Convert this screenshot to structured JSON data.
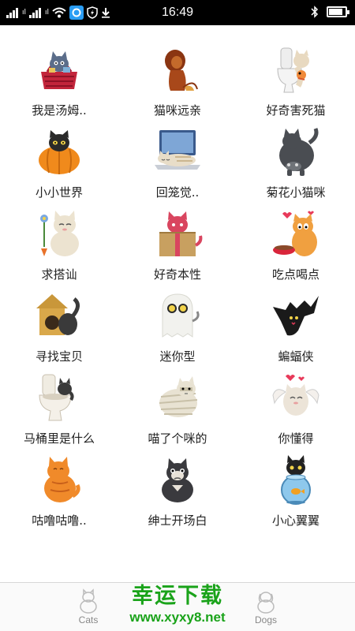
{
  "status_bar": {
    "time": "16:49",
    "signal_label_1": "ıl",
    "signal_label_2": "ıl"
  },
  "stickers": [
    {
      "label": "我是汤姆..",
      "icon": "cat-in-basket-icon"
    },
    {
      "label": "猫咪远亲",
      "icon": "lion-icon"
    },
    {
      "label": "好奇害死猫",
      "icon": "cat-toilet-icon"
    },
    {
      "label": "小小世界",
      "icon": "cat-pumpkin-icon"
    },
    {
      "label": "回笼觉..",
      "icon": "cat-laptop-icon"
    },
    {
      "label": "菊花小猫咪",
      "icon": "cat-back-icon"
    },
    {
      "label": "求搭讪",
      "icon": "cat-flower-icon"
    },
    {
      "label": "好奇本性",
      "icon": "cat-gift-box-icon"
    },
    {
      "label": "吃点喝点",
      "icon": "cat-food-bowl-icon"
    },
    {
      "label": "寻找宝贝",
      "icon": "cat-house-icon"
    },
    {
      "label": "迷你型",
      "icon": "cat-ghost-icon"
    },
    {
      "label": "蝙蝠侠",
      "icon": "cat-bat-icon"
    },
    {
      "label": "马桶里是什么",
      "icon": "cat-toilet-bowl-icon"
    },
    {
      "label": "喵了个咪的",
      "icon": "cat-mummy-icon"
    },
    {
      "label": "你懂得",
      "icon": "cat-wings-icon"
    },
    {
      "label": "咕噜咕噜..",
      "icon": "orange-cat-icon"
    },
    {
      "label": "绅士开场白",
      "icon": "cat-gentleman-icon"
    },
    {
      "label": "小心翼翼",
      "icon": "cat-fishbowl-icon"
    }
  ],
  "tabs": {
    "cats": "Cats",
    "dogs": "Dogs"
  },
  "watermark": {
    "title": "幸运下载",
    "url": "www.xyxy8.net"
  },
  "colors": {
    "watermark": "#1aa31a",
    "status_bar": "#000000"
  }
}
